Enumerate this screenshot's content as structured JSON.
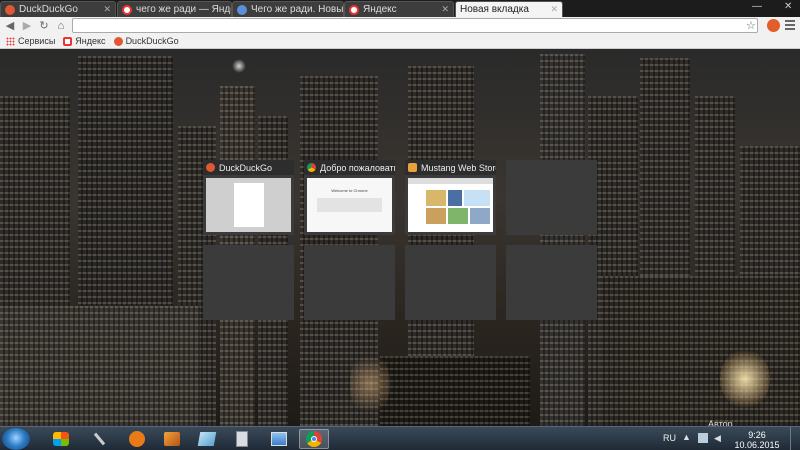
{
  "tabs": [
    {
      "title": "DuckDuckGo",
      "icon": "duckduckgo-icon",
      "color": "#de5833"
    },
    {
      "title": "чего же ради — Яндекс",
      "icon": "yandex-icon",
      "color": "#ffffff"
    },
    {
      "title": "Чего же ради. Новый СТ",
      "icon": "globe-icon",
      "color": "#5b8fd8"
    },
    {
      "title": "Яндекс",
      "icon": "yandex-icon",
      "color": "#ffffff"
    },
    {
      "title": "Новая вкладка",
      "icon": "",
      "color": ""
    }
  ],
  "window_controls": {
    "minimize": "—",
    "close": "✕"
  },
  "address_bar": {
    "value": ""
  },
  "bookmarks": [
    {
      "label": "Сервисы",
      "icon": "apps-grid-icon"
    },
    {
      "label": "Яндекс",
      "icon": "yandex-icon"
    },
    {
      "label": "DuckDuckGo",
      "icon": "duckduckgo-icon"
    }
  ],
  "most_visited": [
    {
      "title": "DuckDuckGo",
      "icon": "duckduckgo-icon",
      "color": "#de5833"
    },
    {
      "title": "Добро пожаловать",
      "icon": "chrome-icon",
      "color": "#4caf50"
    },
    {
      "title": "Mustang Web Store",
      "icon": "store-icon",
      "color": "#e9a23b"
    },
    {
      "title": "",
      "icon": "",
      "color": ""
    },
    {
      "title": "",
      "icon": "",
      "color": ""
    },
    {
      "title": "",
      "icon": "",
      "color": ""
    },
    {
      "title": "",
      "icon": "",
      "color": ""
    },
    {
      "title": "",
      "icon": "",
      "color": ""
    }
  ],
  "thumbnail_text": {
    "welcome": "Welcome to Chrome"
  },
  "taskbar": {
    "language": "RU",
    "time": "9:26",
    "date": "10.06.2015",
    "apps": [
      "windows-live-icon",
      "joystick-icon",
      "media-player-icon",
      "firefox-icon",
      "notepad-icon",
      "calculator-icon",
      "paint-icon",
      "chrome-icon"
    ]
  },
  "watermark": "Автор"
}
